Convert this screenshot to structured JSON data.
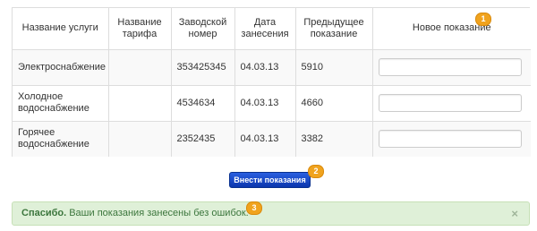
{
  "table": {
    "headers": {
      "service": "Название услуги",
      "tariff": "Название тарифа",
      "serial": "Заводской номер",
      "date": "Дата занесения",
      "previous": "Предыдущее показание",
      "new_reading": "Новое показание"
    },
    "rows": [
      {
        "service": "Электроснабжение",
        "tariff": "",
        "serial": "353425345",
        "date": "04.03.13",
        "previous": "5910",
        "new_reading": ""
      },
      {
        "service": "Холодное водоснабжение",
        "tariff": "",
        "serial": "4534634",
        "date": "04.03.13",
        "previous": "4660",
        "new_reading": ""
      },
      {
        "service": "Горячее водоснабжение",
        "tariff": "",
        "serial": "2352435",
        "date": "04.03.13",
        "previous": "3382",
        "new_reading": ""
      }
    ]
  },
  "badges": {
    "one": "1",
    "two": "2",
    "three": "3"
  },
  "submit_label": "Внести показания",
  "alert": {
    "strong": "Спасибо.",
    "message": " Ваши показания занесены без ошибок.",
    "close": "×"
  },
  "colors": {
    "badge": "#f0a31e",
    "button": "#0d3fc4",
    "alert_bg": "#dff0d8",
    "alert_text": "#3c763d"
  }
}
